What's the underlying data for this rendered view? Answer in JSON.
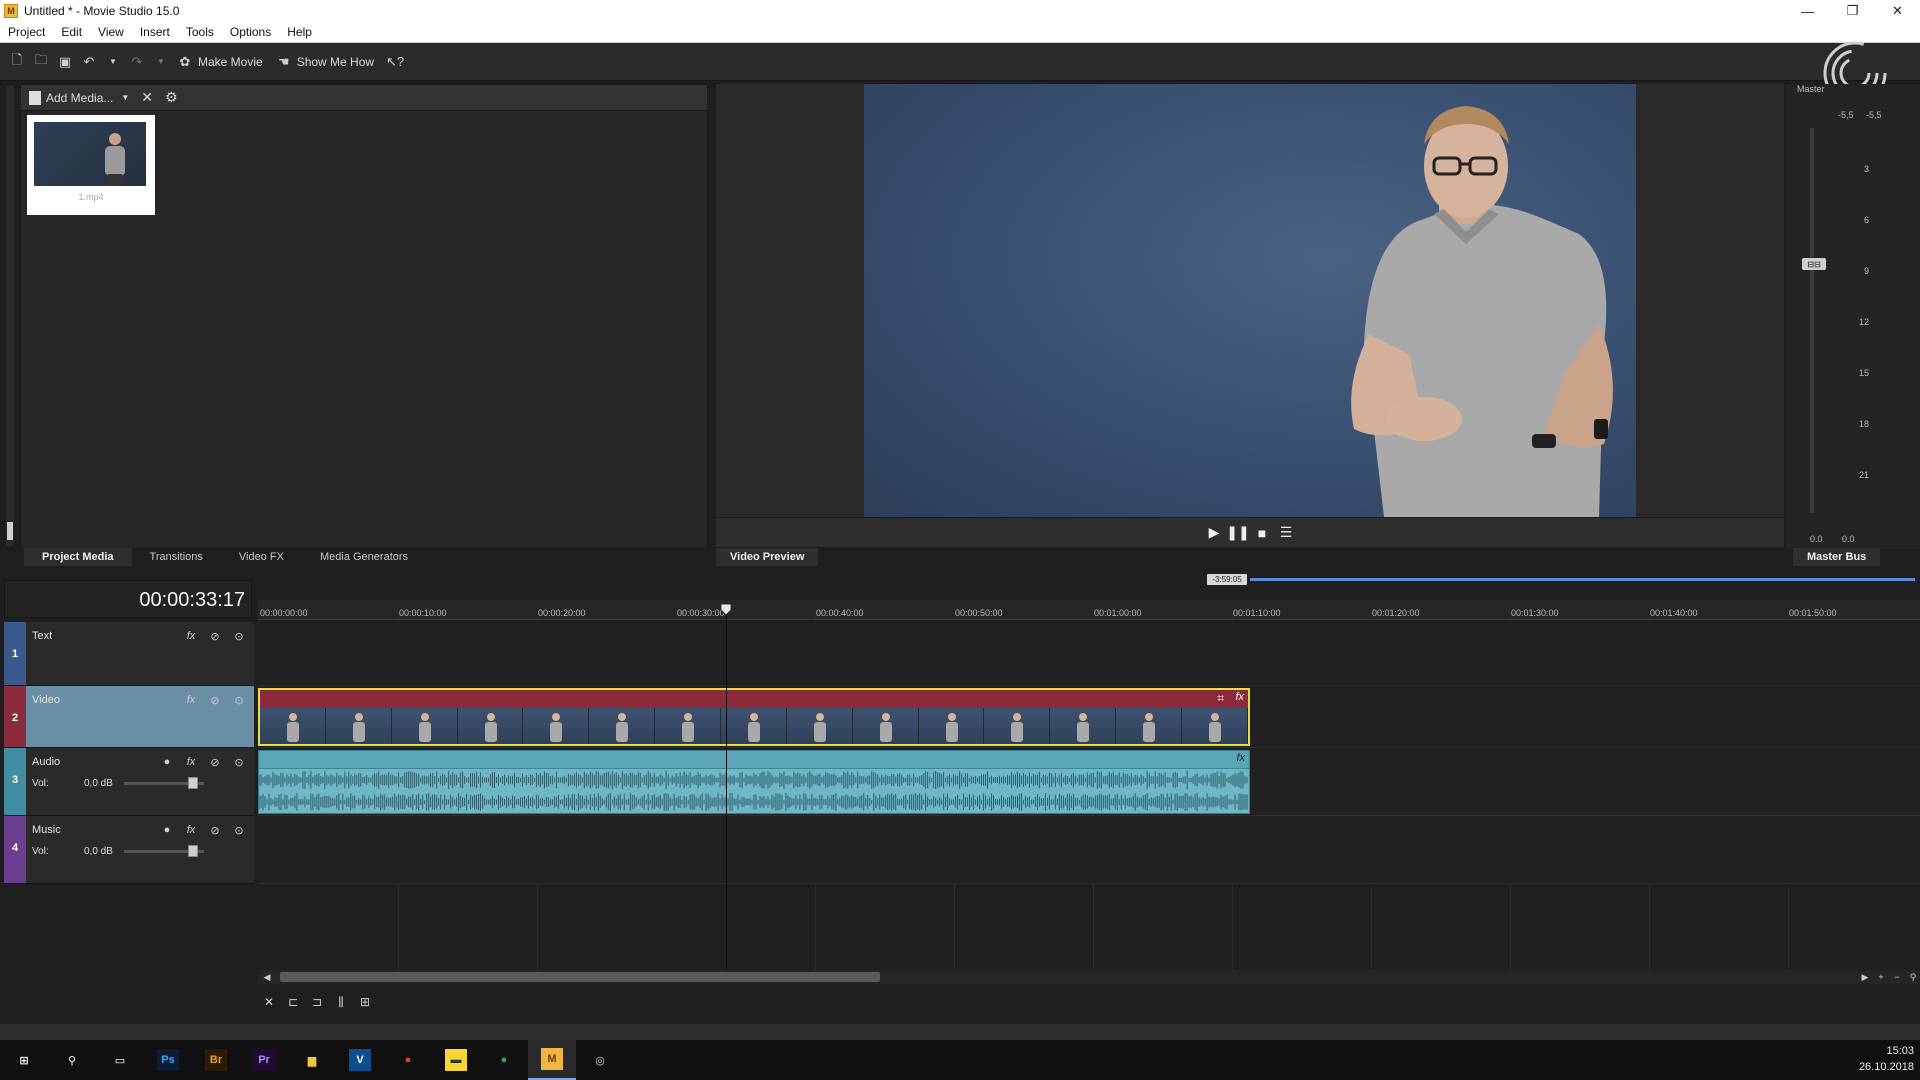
{
  "window": {
    "title": "Untitled * - Movie Studio 15.0",
    "minimize": "—",
    "maximize": "❐",
    "close": "✕"
  },
  "menu": [
    "Project",
    "Edit",
    "View",
    "Insert",
    "Tools",
    "Options",
    "Help"
  ],
  "toolbar": {
    "make_movie": "Make Movie",
    "show_me_how": "Show Me How"
  },
  "media_panel": {
    "add_media": "Add Media...",
    "thumbnail_caption": "1.mp4"
  },
  "left_tabs": [
    "Project Media",
    "Transitions",
    "Video FX",
    "Media Generators"
  ],
  "preview": {
    "tab": "Video Preview"
  },
  "master": {
    "tab": "Master Bus",
    "label": "Master",
    "top_left": "-5,5",
    "top_right": "-5,5",
    "scale": [
      "3",
      "6",
      "9",
      "12",
      "15",
      "18",
      "21"
    ],
    "bottom_left": "0.0",
    "bottom_right": "0.0"
  },
  "timeline": {
    "current_time": "00:00:33:17",
    "loop_badge": "-3:59:05",
    "ruler": [
      "00:00:00:00",
      "00:00:10:00",
      "00:00:20:00",
      "00:00:30:00",
      "00:00:40:00",
      "00:00:50:00",
      "00:01:00:00",
      "00:01:10:00",
      "00:01:20:00",
      "00:01:30:00",
      "00:01:40:00",
      "00:01:50:00"
    ],
    "tracks": [
      {
        "num": "1",
        "name": "Text",
        "color": "#3b5a8c"
      },
      {
        "num": "2",
        "name": "Video",
        "color": "#8a2b3e"
      },
      {
        "num": "3",
        "name": "Audio",
        "color": "#3f8fa0",
        "vol_label": "Vol:",
        "vol_value": "0,0 dB"
      },
      {
        "num": "4",
        "name": "Music",
        "color": "#6a3f8e",
        "vol_label": "Vol:",
        "vol_value": "0,0 dB"
      }
    ]
  },
  "tray": {
    "time": "15:03",
    "date": "26.10.2018"
  },
  "taskbar": [
    {
      "name": "start",
      "label": "⊞",
      "bg": "transparent",
      "fg": "#ffffff"
    },
    {
      "name": "search",
      "label": "⚲",
      "bg": "transparent",
      "fg": "#ffffff"
    },
    {
      "name": "task-view",
      "label": "▭",
      "bg": "transparent",
      "fg": "#ffffff"
    },
    {
      "name": "photoshop",
      "label": "Ps",
      "bg": "#0e1b33",
      "fg": "#31a8ff"
    },
    {
      "name": "bridge",
      "label": "Br",
      "bg": "#2a1a06",
      "fg": "#e6a020"
    },
    {
      "name": "premiere",
      "label": "Pr",
      "bg": "#1f0a33",
      "fg": "#b58cff"
    },
    {
      "name": "explorer",
      "label": "▆",
      "bg": "transparent",
      "fg": "#f3c43c"
    },
    {
      "name": "vegas",
      "label": "V",
      "bg": "#0d4f8c",
      "fg": "#ffffff"
    },
    {
      "name": "chrome",
      "label": "●",
      "bg": "transparent",
      "fg": "#e94235"
    },
    {
      "name": "sticky-notes",
      "label": "▬",
      "bg": "#f6d632",
      "fg": "#333333"
    },
    {
      "name": "chrome-2",
      "label": "●",
      "bg": "transparent",
      "fg": "#34a853"
    },
    {
      "name": "movie-studio",
      "label": "M",
      "bg": "#f1b640",
      "fg": "#6b3b00"
    },
    {
      "name": "capture",
      "label": "◎",
      "bg": "transparent",
      "fg": "#dddddd"
    }
  ]
}
